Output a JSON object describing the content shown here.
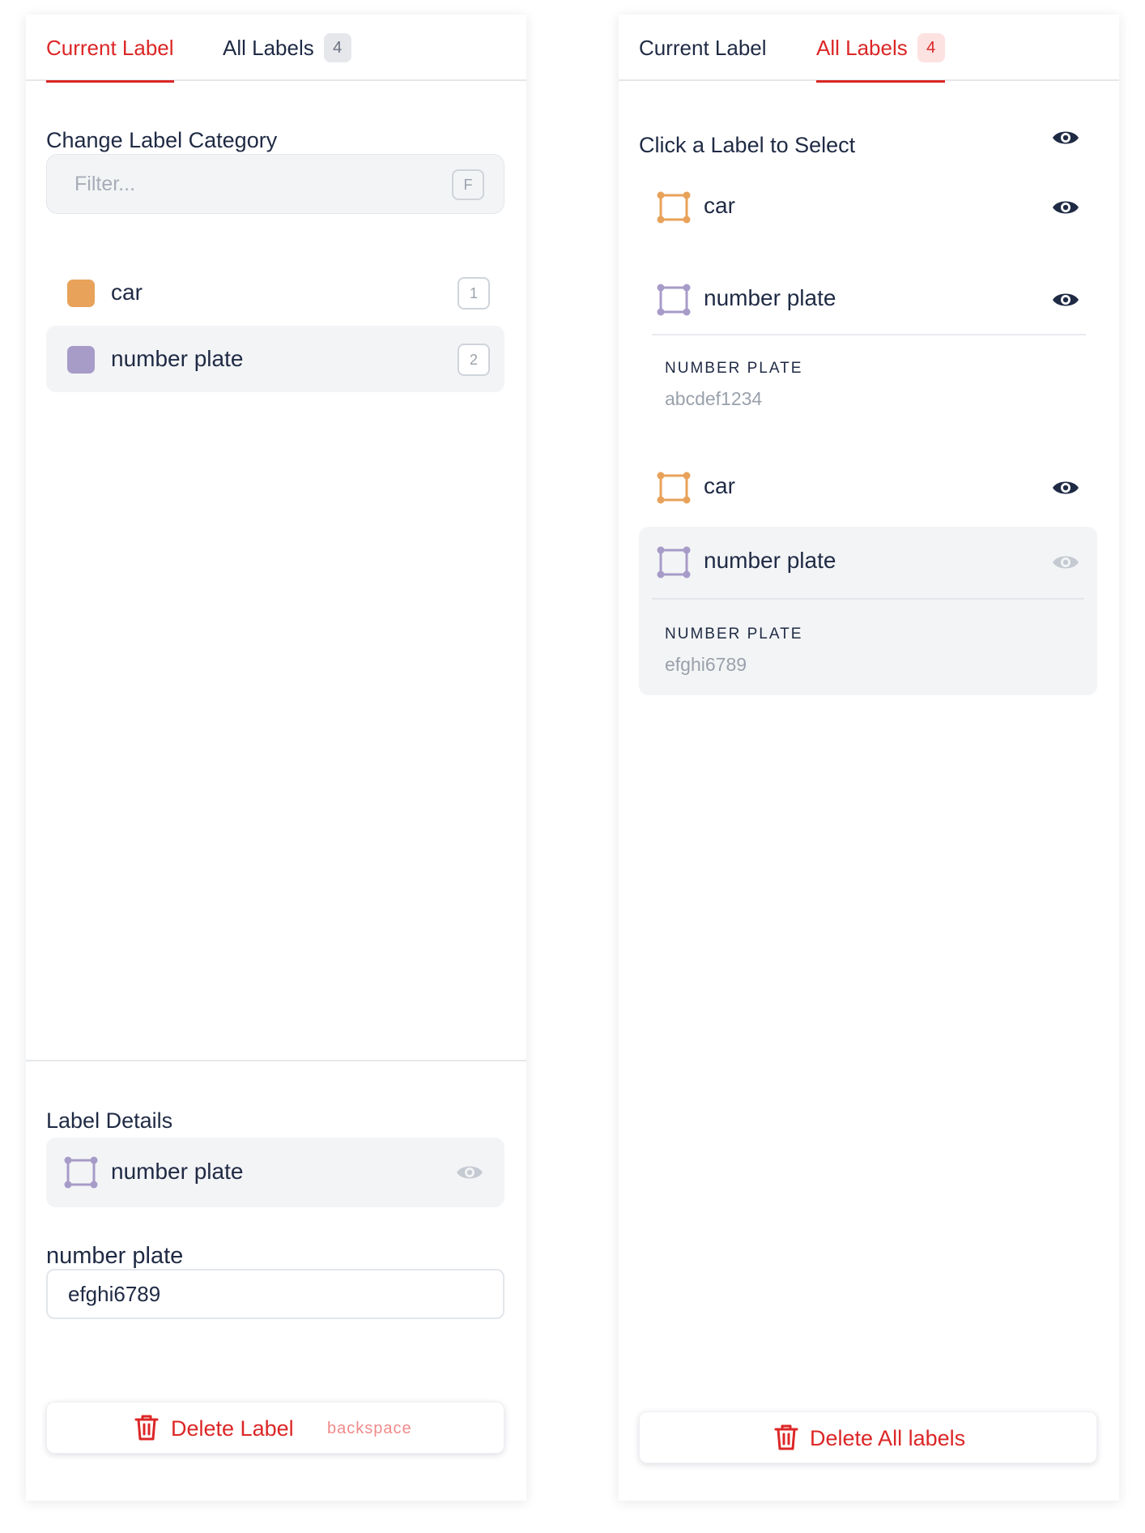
{
  "colors": {
    "accent": "#dc2626",
    "car": "#e8a25a",
    "number_plate": "#a79bc8",
    "text": "#1f2a44",
    "muted": "#9aa1ab"
  },
  "left_panel": {
    "tabs": {
      "current": "Current Label",
      "all": "All Labels",
      "all_count": "4"
    },
    "category_title": "Change Label Category",
    "filter": {
      "placeholder": "Filter...",
      "shortcut": "F"
    },
    "categories": [
      {
        "label": "car",
        "shortcut": "1",
        "color": "#e8a25a"
      },
      {
        "label": "number plate",
        "shortcut": "2",
        "color": "#a79bc8"
      }
    ],
    "details": {
      "title": "Label Details",
      "selected_label": "number plate",
      "field_label": "number plate",
      "field_value": "efghi6789"
    },
    "delete": {
      "label": "Delete Label",
      "shortcut": "backspace"
    }
  },
  "right_panel": {
    "tabs": {
      "current": "Current Label",
      "all": "All Labels",
      "all_count": "4"
    },
    "title": "Click a Label to Select",
    "labels": [
      {
        "name": "car",
        "icon": "bbox-icon"
      },
      {
        "name": "number plate",
        "icon": "bbox-icon",
        "attr_key": "NUMBER PLATE",
        "attr_value": "abcdef1234"
      },
      {
        "name": "car",
        "icon": "bbox-icon"
      },
      {
        "name": "number plate",
        "icon": "bbox-icon",
        "attr_key": "NUMBER PLATE",
        "attr_value": "efghi6789"
      }
    ],
    "delete_all": {
      "label": "Delete All labels"
    }
  }
}
